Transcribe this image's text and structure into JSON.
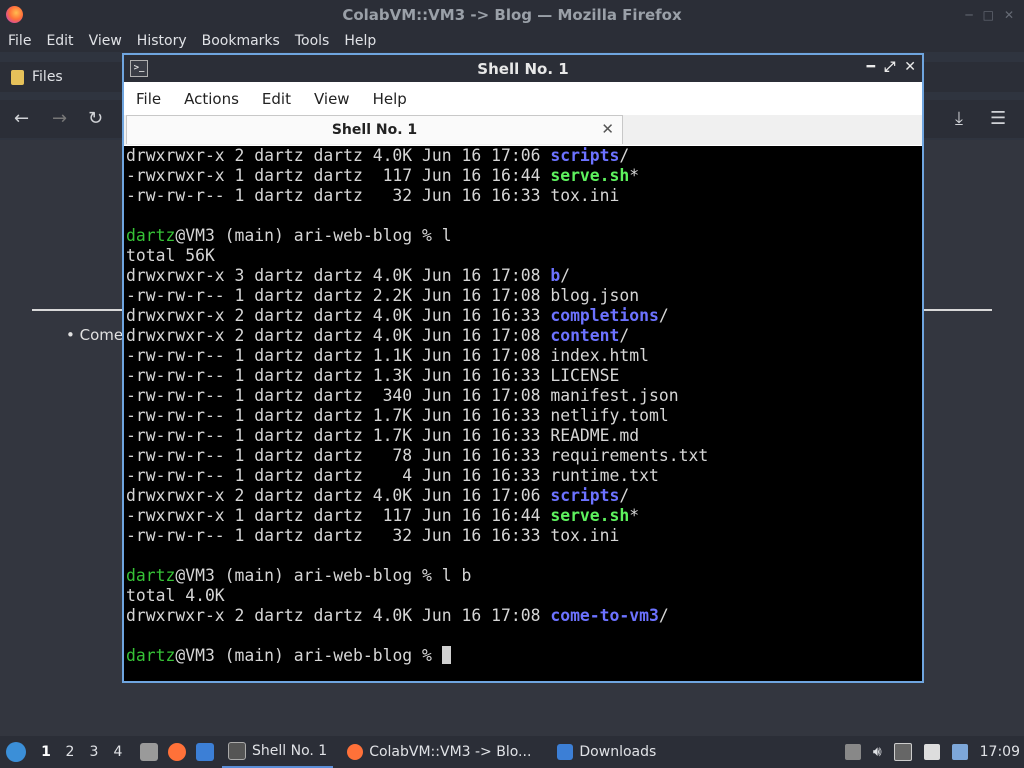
{
  "firefox": {
    "title": "ColabVM::VM3 -> Blog — Mozilla Firefox",
    "menu": [
      "File",
      "Edit",
      "View",
      "History",
      "Bookmarks",
      "Tools",
      "Help"
    ],
    "bookmark": "Files",
    "page_bullet": "Come"
  },
  "terminal": {
    "title": "Shell No. 1",
    "menu": [
      "File",
      "Actions",
      "Edit",
      "View",
      "Help"
    ],
    "tab_label": "Shell No. 1",
    "lines": [
      [
        {
          "t": "drwxrwxr-x 2 dartz dartz 4.0K Jun 16 17:06 "
        },
        {
          "t": "scripts",
          "c": "dir"
        },
        {
          "t": "/"
        }
      ],
      [
        {
          "t": "-rwxrwxr-x 1 dartz dartz  117 Jun 16 16:44 "
        },
        {
          "t": "serve.sh",
          "c": "exe"
        },
        {
          "t": "*"
        }
      ],
      [
        {
          "t": "-rw-rw-r-- 1 dartz dartz   32 Jun 16 16:33 tox.ini"
        }
      ],
      [],
      [
        {
          "t": "dartz",
          "c": "usr"
        },
        {
          "t": "@VM3 (main) ari-web-blog % l"
        }
      ],
      [
        {
          "t": "total 56K"
        }
      ],
      [
        {
          "t": "drwxrwxr-x 3 dartz dartz 4.0K Jun 16 17:08 "
        },
        {
          "t": "b",
          "c": "dir"
        },
        {
          "t": "/"
        }
      ],
      [
        {
          "t": "-rw-rw-r-- 1 dartz dartz 2.2K Jun 16 17:08 blog.json"
        }
      ],
      [
        {
          "t": "drwxrwxr-x 2 dartz dartz 4.0K Jun 16 16:33 "
        },
        {
          "t": "completions",
          "c": "dir"
        },
        {
          "t": "/"
        }
      ],
      [
        {
          "t": "drwxrwxr-x 2 dartz dartz 4.0K Jun 16 17:08 "
        },
        {
          "t": "content",
          "c": "dir"
        },
        {
          "t": "/"
        }
      ],
      [
        {
          "t": "-rw-rw-r-- 1 dartz dartz 1.1K Jun 16 17:08 index.html"
        }
      ],
      [
        {
          "t": "-rw-rw-r-- 1 dartz dartz 1.3K Jun 16 16:33 LICENSE"
        }
      ],
      [
        {
          "t": "-rw-rw-r-- 1 dartz dartz  340 Jun 16 17:08 manifest.json"
        }
      ],
      [
        {
          "t": "-rw-rw-r-- 1 dartz dartz 1.7K Jun 16 16:33 netlify.toml"
        }
      ],
      [
        {
          "t": "-rw-rw-r-- 1 dartz dartz 1.7K Jun 16 16:33 README.md"
        }
      ],
      [
        {
          "t": "-rw-rw-r-- 1 dartz dartz   78 Jun 16 16:33 requirements.txt"
        }
      ],
      [
        {
          "t": "-rw-rw-r-- 1 dartz dartz    4 Jun 16 16:33 runtime.txt"
        }
      ],
      [
        {
          "t": "drwxrwxr-x 2 dartz dartz 4.0K Jun 16 17:06 "
        },
        {
          "t": "scripts",
          "c": "dir"
        },
        {
          "t": "/"
        }
      ],
      [
        {
          "t": "-rwxrwxr-x 1 dartz dartz  117 Jun 16 16:44 "
        },
        {
          "t": "serve.sh",
          "c": "exe"
        },
        {
          "t": "*"
        }
      ],
      [
        {
          "t": "-rw-rw-r-- 1 dartz dartz   32 Jun 16 16:33 tox.ini"
        }
      ],
      [],
      [
        {
          "t": "dartz",
          "c": "usr"
        },
        {
          "t": "@VM3 (main) ari-web-blog % l b"
        }
      ],
      [
        {
          "t": "total 4.0K"
        }
      ],
      [
        {
          "t": "drwxrwxr-x 2 dartz dartz 4.0K Jun 16 17:08 "
        },
        {
          "t": "come-to-vm3",
          "c": "dir"
        },
        {
          "t": "/"
        }
      ],
      [],
      [
        {
          "t": "dartz",
          "c": "usr"
        },
        {
          "t": "@VM3 (main) ari-web-blog % "
        },
        {
          "t": "",
          "c": "cursor"
        }
      ]
    ]
  },
  "taskbar": {
    "workspaces": [
      "1",
      "2",
      "3",
      "4"
    ],
    "tasks": [
      {
        "label": "Shell No. 1",
        "icon": "terminal-icon",
        "active": true
      },
      {
        "label": "ColabVM::VM3 -> Blo...",
        "icon": "firefox-icon",
        "active": false
      },
      {
        "label": "Downloads",
        "icon": "folder-icon",
        "active": false
      }
    ],
    "clock": "17:09"
  },
  "colors": {
    "accent": "#6fa5df",
    "dir": "#6c72ff",
    "exe": "#5ef25e",
    "user": "#36c236"
  }
}
